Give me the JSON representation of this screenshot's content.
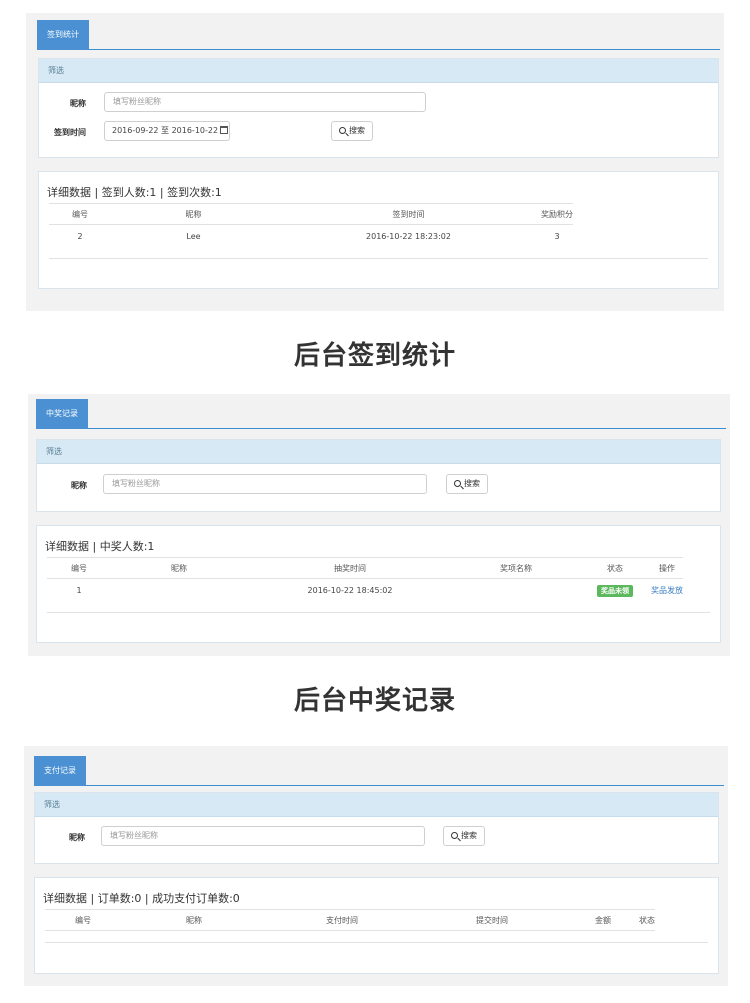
{
  "checkin": {
    "tab": "签到统计",
    "filter_title": "筛选",
    "nickname_label": "昵称",
    "nickname_placeholder": "填写粉丝昵称",
    "time_label": "签到时间",
    "date_range": "2016-09-22 至 2016-10-22",
    "search_label": "搜索",
    "data_title": "详细数据 | 签到人数:1 | 签到次数:1",
    "columns": [
      "编号",
      "昵称",
      "签到时间",
      "奖励积分"
    ],
    "rows": [
      [
        "2",
        "Lee",
        "2016-10-22 18:23:02",
        "3"
      ]
    ],
    "caption": "后台签到统计"
  },
  "prize": {
    "tab": "中奖记录",
    "filter_title": "筛选",
    "nickname_label": "昵称",
    "nickname_placeholder": "填写粉丝昵称",
    "search_label": "搜索",
    "data_title": "详细数据 | 中奖人数:1",
    "columns": [
      "编号",
      "昵称",
      "抽奖时间",
      "奖项名称",
      "状态",
      "操作"
    ],
    "row": {
      "id": "1",
      "nickname": "",
      "time": "2016-10-22 18:45:02",
      "prize_name": "",
      "status": "奖品未领",
      "action": "奖品发放"
    },
    "caption": "后台中奖记录"
  },
  "payment": {
    "tab": "支付记录",
    "filter_title": "筛选",
    "nickname_label": "昵称",
    "nickname_placeholder": "填写粉丝昵称",
    "search_label": "搜索",
    "data_title": "详细数据 | 订单数:0 | 成功支付订单数:0",
    "columns": [
      "编号",
      "昵称",
      "支付时间",
      "提交时间",
      "金额",
      "状态"
    ]
  },
  "colors": {
    "accent": "#4a90d2",
    "filter_bg": "#d6e9f5",
    "status_green": "#5cb85c",
    "link": "#3b7fc4"
  }
}
